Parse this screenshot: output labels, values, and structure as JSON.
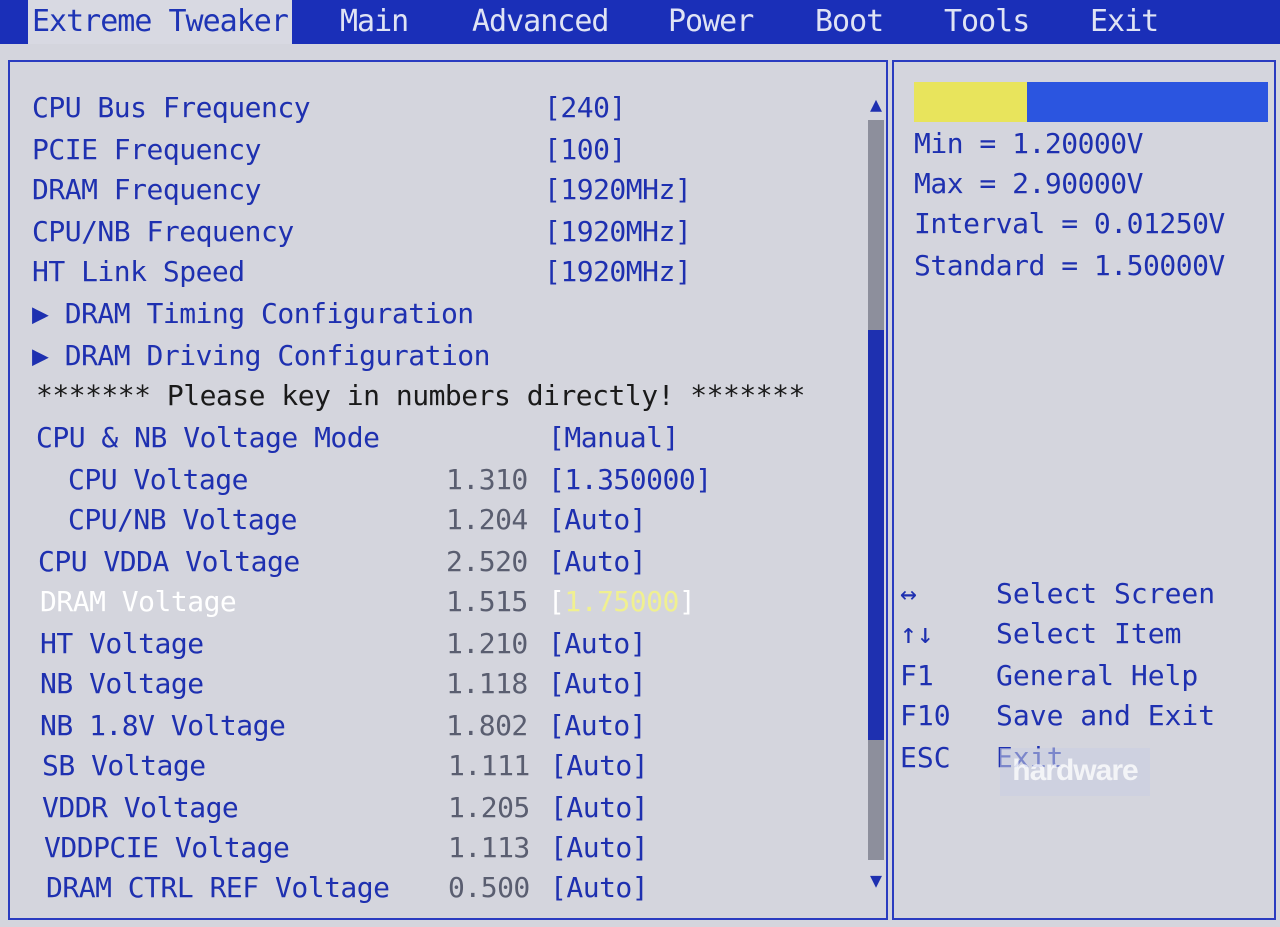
{
  "menu": {
    "tabs": [
      {
        "label": "Extreme Tweaker",
        "active": true
      },
      {
        "label": "Main"
      },
      {
        "label": "Advanced"
      },
      {
        "label": "Power"
      },
      {
        "label": "Boot"
      },
      {
        "label": "Tools"
      },
      {
        "label": "Exit"
      }
    ]
  },
  "settings": [
    {
      "label": "CPU Bus Frequency",
      "value": "[240]"
    },
    {
      "label": "PCIE Frequency",
      "value": "[100]"
    },
    {
      "label": "DRAM Frequency",
      "value": "[1920MHz]"
    },
    {
      "label": "CPU/NB Frequency",
      "value": "[1920MHz]"
    },
    {
      "label": "HT Link Speed",
      "value": "[1920MHz]"
    },
    {
      "label": "DRAM Timing Configuration",
      "submenu": true
    },
    {
      "label": "DRAM Driving Configuration",
      "submenu": true
    },
    {
      "label": "******* Please key in numbers directly! *******",
      "banner": true
    },
    {
      "label": "CPU & NB Voltage Mode",
      "value": "[Manual]"
    },
    {
      "label": "CPU Voltage",
      "reading": "1.310",
      "value": "[1.350000]",
      "indent": true
    },
    {
      "label": "CPU/NB Voltage",
      "reading": "1.204",
      "value": "[Auto]",
      "indent": true
    },
    {
      "label": "CPU VDDA Voltage",
      "reading": "2.520",
      "value": "[Auto]"
    },
    {
      "label": "DRAM Voltage",
      "reading": "1.515",
      "value": "1.75000",
      "selected": true
    },
    {
      "label": "HT Voltage",
      "reading": "1.210",
      "value": "[Auto]"
    },
    {
      "label": "NB Voltage",
      "reading": "1.118",
      "value": "[Auto]"
    },
    {
      "label": "NB 1.8V Voltage",
      "reading": "1.802",
      "value": "[Auto]"
    },
    {
      "label": "SB Voltage",
      "reading": "1.111",
      "value": "[Auto]"
    },
    {
      "label": "VDDR Voltage",
      "reading": "1.205",
      "value": "[Auto]"
    },
    {
      "label": "VDDPCIE Voltage",
      "reading": "1.113",
      "value": "[Auto]"
    },
    {
      "label": "DRAM CTRL REF Voltage",
      "reading": "0.500",
      "value": "[Auto]"
    }
  ],
  "help": {
    "min": "Min = 1.20000V",
    "max": "Max = 2.90000V",
    "interval": "Interval = 0.01250V",
    "standard": "Standard = 1.50000V",
    "level_fraction": 0.32,
    "colors": {
      "fill": "#e8e45c",
      "bar": "#2b55e0"
    }
  },
  "keys": [
    {
      "key": "↔",
      "desc": "Select Screen"
    },
    {
      "key": "↑↓",
      "desc": "Select Item"
    },
    {
      "key": "F1",
      "desc": "General Help"
    },
    {
      "key": "F10",
      "desc": "Save and Exit"
    },
    {
      "key": "ESC",
      "desc": "Exit"
    }
  ],
  "watermark": "hardware",
  "scroll": {
    "up": "▲",
    "down": "▼"
  }
}
